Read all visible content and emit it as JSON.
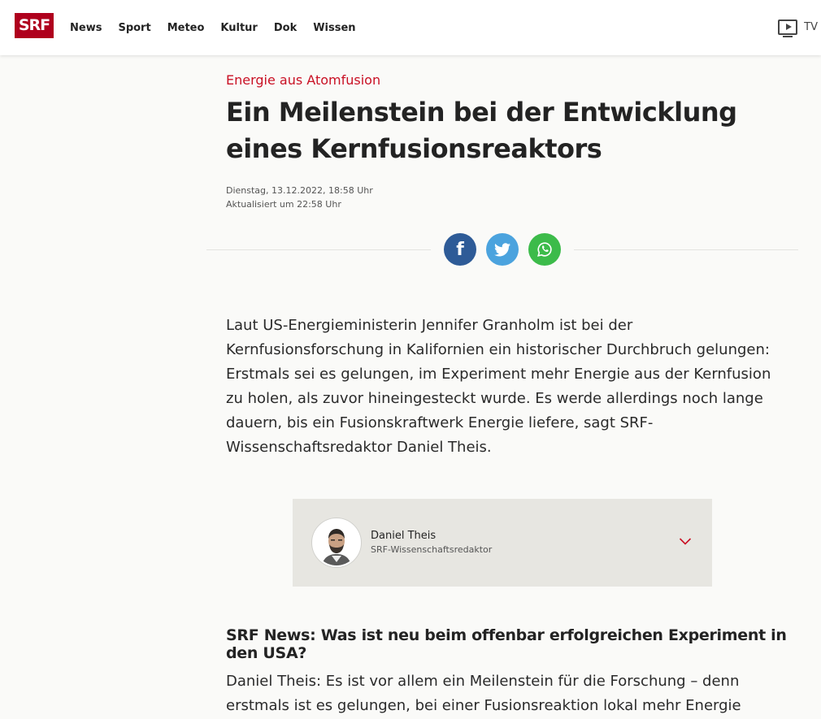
{
  "header": {
    "logo": "SRF",
    "nav": [
      "News",
      "Sport",
      "Meteo",
      "Kultur",
      "Dok",
      "Wissen"
    ],
    "tv_label": "TV"
  },
  "article": {
    "kicker": "Energie aus Atomfusion",
    "title": "Ein Meilenstein bei der Entwicklung eines Kernfusionsreaktors",
    "date": "Dienstag, 13.12.2022, 18:58 Uhr",
    "updated": "Aktualisiert um 22:58 Uhr",
    "share": {
      "facebook_glyph": "f",
      "colors": {
        "facebook": "#2e5b97",
        "twitter": "#4ba3de",
        "whatsapp": "#3cbb4a"
      }
    },
    "lead": "Laut US-Energieministerin Jennifer Granholm ist bei der Kernfusionsforschung in Kalifornien ein historischer Durchbruch gelungen: Erstmals sei es gelungen, im Experiment mehr Energie aus der Kernfusion zu holen, als zuvor hineingesteckt wurde. Es werde allerdings noch lange dauern, bis ein Fusionskraftwerk Energie liefere, sagt SRF-Wissenschaftsredaktor Daniel Theis.",
    "author": {
      "name": "Daniel Theis",
      "role": "SRF-Wissenschaftsredaktor"
    },
    "question": "SRF News: Was ist neu beim offenbar erfolgreichen Experiment in den USA?",
    "answer": "Daniel Theis: Es ist vor allem ein Meilenstein für die Forschung – denn erstmals ist es gelungen, bei einer Fusionsreaktion lokal mehr Energie herauszuholen,"
  },
  "colors": {
    "brand": "#af001d",
    "kicker": "#c91024"
  }
}
